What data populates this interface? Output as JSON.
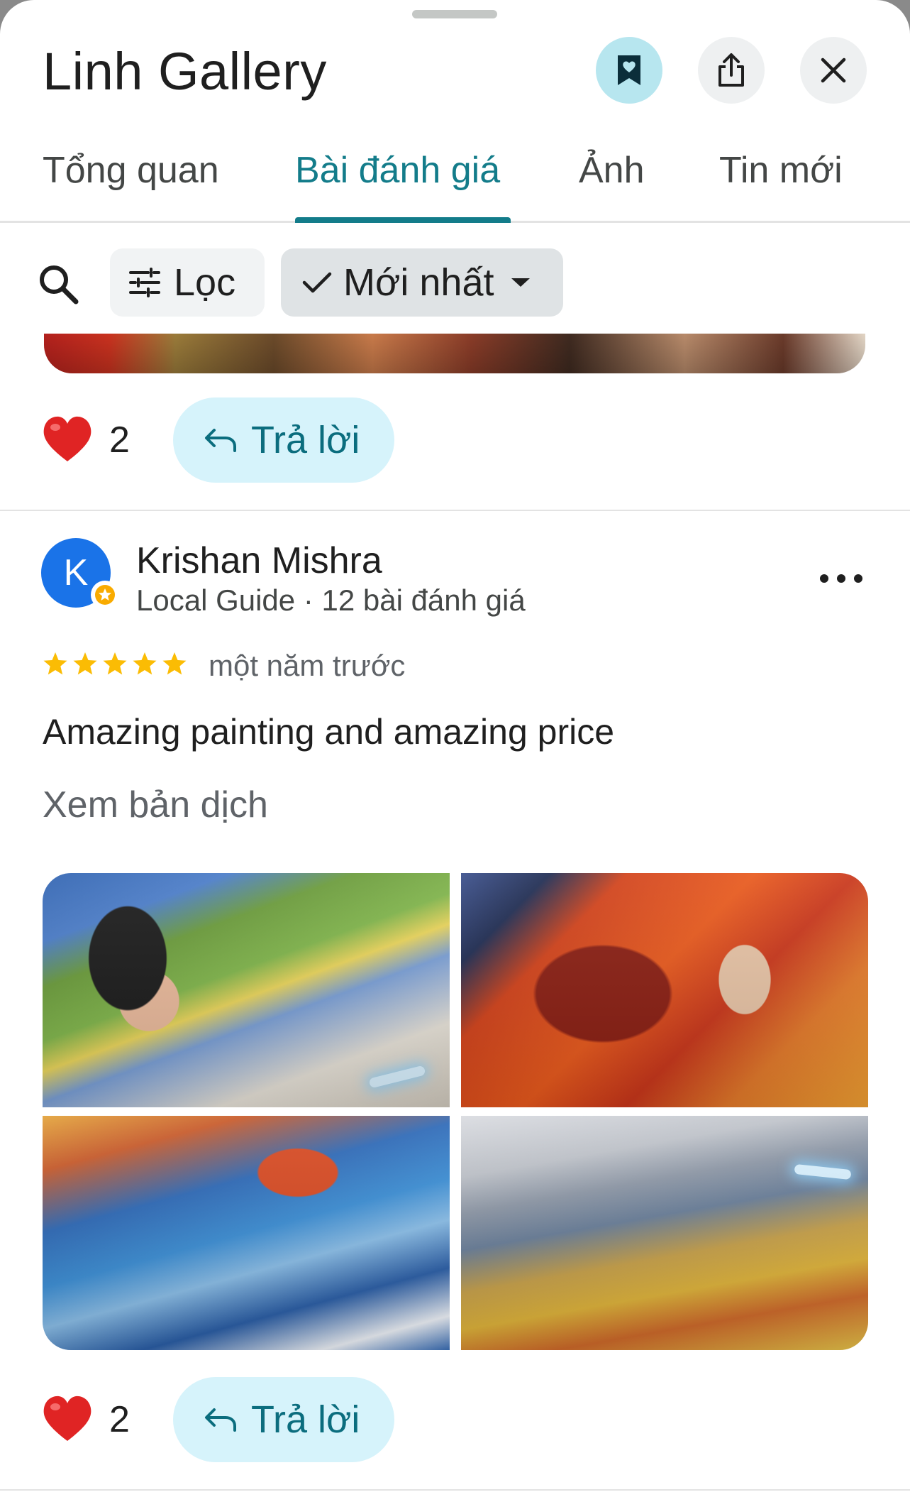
{
  "header": {
    "title": "Linh Gallery",
    "icons": {
      "save": "bookmark-heart-icon",
      "share": "share-icon",
      "close": "close-icon"
    }
  },
  "tabs": [
    {
      "label": "Tổng quan",
      "active": false
    },
    {
      "label": "Bài đánh giá",
      "active": true
    },
    {
      "label": "Ảnh",
      "active": false
    },
    {
      "label": "Tin mới",
      "active": false
    }
  ],
  "filters": {
    "search_icon": "search-icon",
    "filter_label": "Lọc",
    "sort_label": "Mới nhất"
  },
  "previous_review": {
    "likes": "2",
    "reply_label": "Trả lời"
  },
  "review": {
    "avatar_letter": "K",
    "reviewer_name": "Krishan Mishra",
    "reviewer_meta": "Local Guide · 12 bài đánh giá",
    "rating": 5,
    "date": "một năm trước",
    "text": "Amazing painting and amazing price",
    "translate_label": "Xem bản dịch",
    "likes": "2",
    "reply_label": "Trả lời"
  },
  "colors": {
    "accent": "#137c8a",
    "reply_bg": "#d6f3fb",
    "save_bg": "#b7e6ef",
    "star": "#fbbc04",
    "heart": "#e02424",
    "avatar": "#1a73e8"
  }
}
